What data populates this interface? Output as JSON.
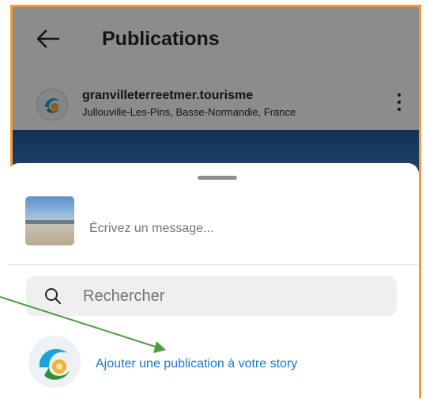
{
  "header": {
    "title": "Publications",
    "back_icon": "arrow-left-icon"
  },
  "post": {
    "username": "granvilleterreetmer.tourisme",
    "location": "Jullouville-Les-Pins, Basse-Normandie, France",
    "menu_icon": "more-vertical-icon"
  },
  "share_sheet": {
    "message_placeholder": "Écrivez un message...",
    "search_placeholder": "Rechercher",
    "search_icon": "search-icon",
    "add_to_story": "Ajouter une publication à votre story"
  },
  "colors": {
    "frame": "#f29a38",
    "link": "#1976d2",
    "annotation_arrow": "#4c9e3f",
    "overlay": "rgba(0,0,0,0.45)"
  }
}
